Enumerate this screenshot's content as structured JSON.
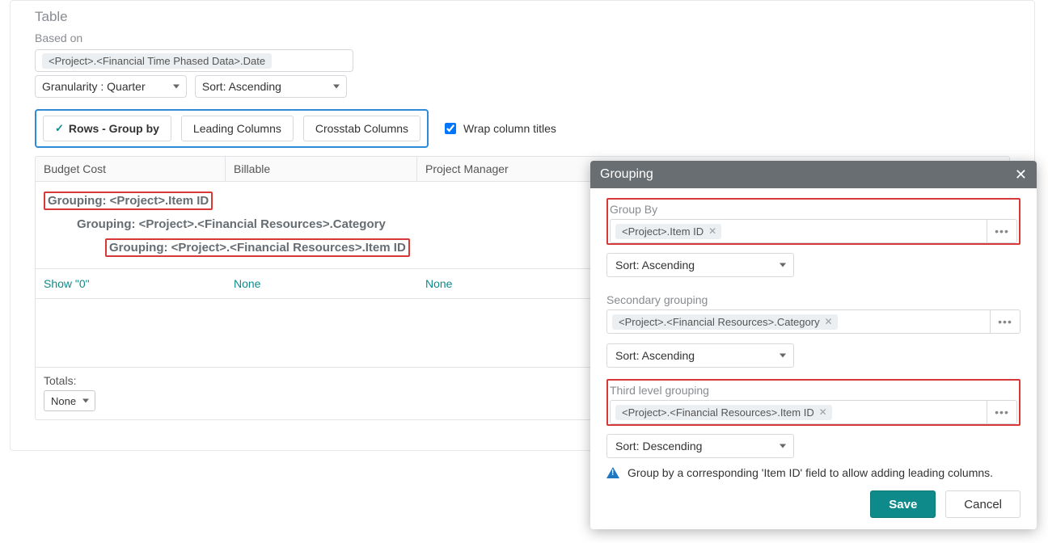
{
  "panel": {
    "title": "Table",
    "based_on_label": "Based on",
    "based_on_value": "<Project>.<Financial Time Phased Data>.Date",
    "granularity": "Granularity : Quarter",
    "based_sort": "Sort: Ascending",
    "tabs": {
      "rows": "Rows - Group by",
      "leading": "Leading Columns",
      "crosstab": "Crosstab Columns"
    },
    "wrap_label": "Wrap column titles",
    "wrap_checked": true,
    "columns": [
      "Budget Cost",
      "Billable",
      "Project Manager"
    ],
    "groupings": [
      "Grouping: <Project>.Item ID",
      "Grouping: <Project>.<Financial Resources>.Category",
      "Grouping: <Project>.<Financial Resources>.Item ID"
    ],
    "show_cells": [
      "Show \"0\"",
      "None",
      "None"
    ],
    "totals_label": "Totals:",
    "totals_value": "None"
  },
  "dialog": {
    "title": "Grouping",
    "sections": [
      {
        "label": "Group By",
        "chip": "<Project>.Item ID",
        "sort": "Sort: Ascending"
      },
      {
        "label": "Secondary grouping",
        "chip": "<Project>.<Financial Resources>.Category",
        "sort": "Sort: Ascending"
      },
      {
        "label": "Third level grouping",
        "chip": "<Project>.<Financial Resources>.Item ID",
        "sort": "Sort: Descending"
      }
    ],
    "info": "Group by a corresponding 'Item ID' field to allow adding leading columns.",
    "save": "Save",
    "cancel": "Cancel",
    "more": "•••"
  }
}
